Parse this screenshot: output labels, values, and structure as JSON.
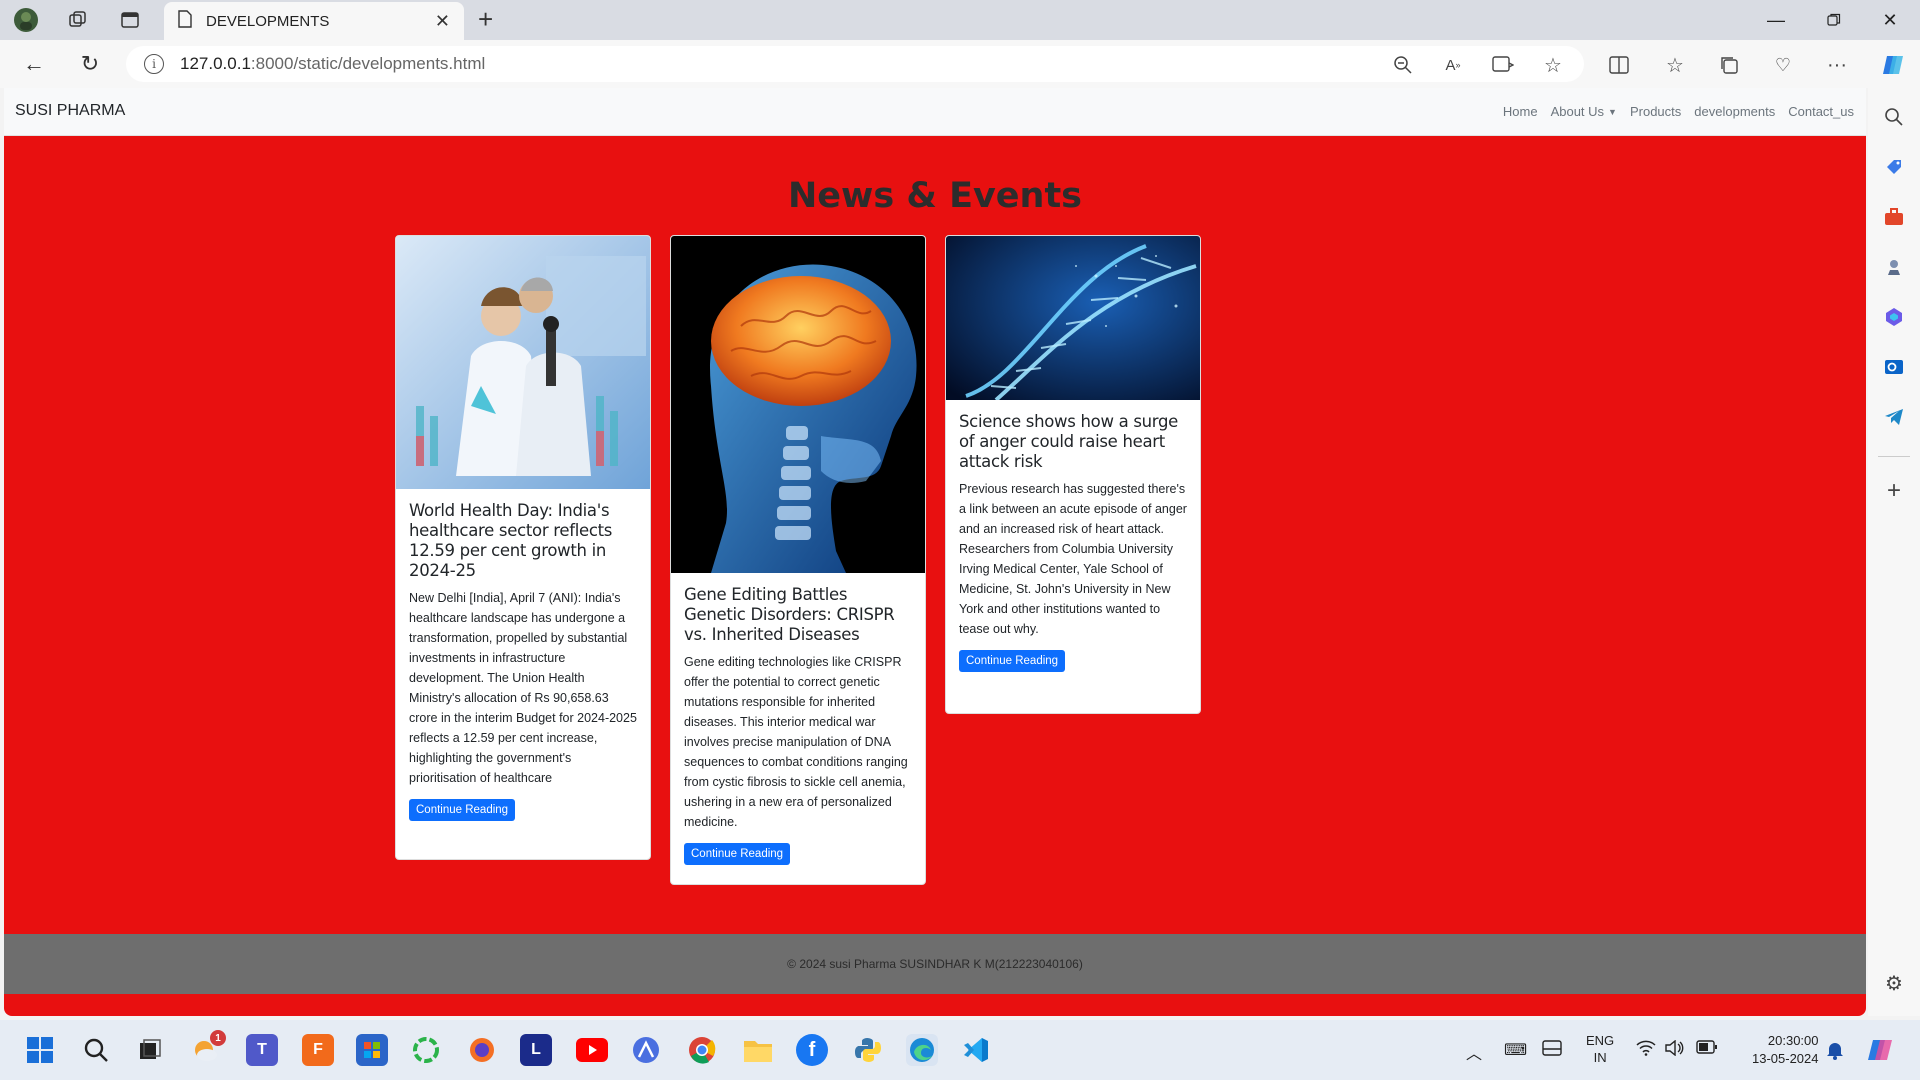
{
  "browser": {
    "tab_title": "DEVELOPMENTS",
    "url_host": "127.0.0.1",
    "url_path": ":8000/static/developments.html",
    "icons": [
      "profile-avatar-icon",
      "workspaces-icon",
      "tab-actions-icon",
      "page-icon",
      "close-tab-icon",
      "new-tab-icon",
      "minimize-icon",
      "restore-icon",
      "close-window-icon",
      "back-icon",
      "refresh-icon",
      "info-icon",
      "zoom-icon",
      "read-aloud-icon",
      "immersive-reader-icon",
      "favorite-star-icon",
      "split-screen-icon",
      "favorites-icon",
      "collections-icon",
      "browser-essentials-icon",
      "more-icon",
      "copilot-icon"
    ]
  },
  "site": {
    "brand": "SUSI PHARMA",
    "nav": {
      "home": "Home",
      "about": "About Us",
      "products": "Products",
      "developments": "developments",
      "contact": "Contact_us"
    },
    "heading": "News & Events",
    "cards": [
      {
        "title": "World Health Day: India's healthcare sector reflects 12.59 per cent growth in 2024-25",
        "text": "New Delhi [India], April 7 (ANI): India's healthcare landscape has undergone a transformation, propelled by substantial investments in infrastructure development. The Union Health Ministry's allocation of Rs 90,658.63 crore in the interim Budget for 2024-2025 reflects a 12.59 per cent increase, highlighting the government's prioritisation of healthcare",
        "button": "Continue Reading"
      },
      {
        "title": "Gene Editing Battles Genetic Disorders: CRISPR vs. Inherited Diseases",
        "text": "Gene editing technologies like CRISPR offer the potential to correct genetic mutations responsible for inherited diseases. This interior medical war involves precise manipulation of DNA sequences to combat conditions ranging from cystic fibrosis to sickle cell anemia, ushering in a new era of personalized medicine.",
        "button": "Continue Reading"
      },
      {
        "title": "Science shows how a surge of anger could raise heart attack risk",
        "text": "Previous research has suggested there's a link between an acute episode of anger and an increased risk of heart attack. Researchers from Columbia University Irving Medical Center, Yale School of Medicine, St. John's University in New York and other institutions wanted to tease out why.",
        "button": "Continue Reading"
      }
    ],
    "footer": "© 2024 susi Pharma SUSINDHAR K M(212223040106)"
  },
  "sidebar_icons": [
    "search-icon",
    "shopping-tag-icon",
    "tools-icon",
    "games-icon",
    "microsoft-365-icon",
    "outlook-icon",
    "telegram-icon",
    "add-icon",
    "settings-icon"
  ],
  "taskbar": {
    "apps": [
      "start-icon",
      "search-icon",
      "task-view-icon",
      "weather-icon",
      "teams-icon",
      "fusion-icon",
      "store-icon",
      "app-ring-icon",
      "firefox-icon",
      "l-app-icon",
      "youtube-icon",
      "arc-icon",
      "chrome-icon",
      "file-explorer-icon",
      "facebook-icon",
      "python-icon",
      "edge-icon",
      "vscode-icon"
    ],
    "notification_badge": "1",
    "lang_top": "ENG",
    "lang_bottom": "IN",
    "time": "20:30:00",
    "date": "13-05-2024"
  }
}
